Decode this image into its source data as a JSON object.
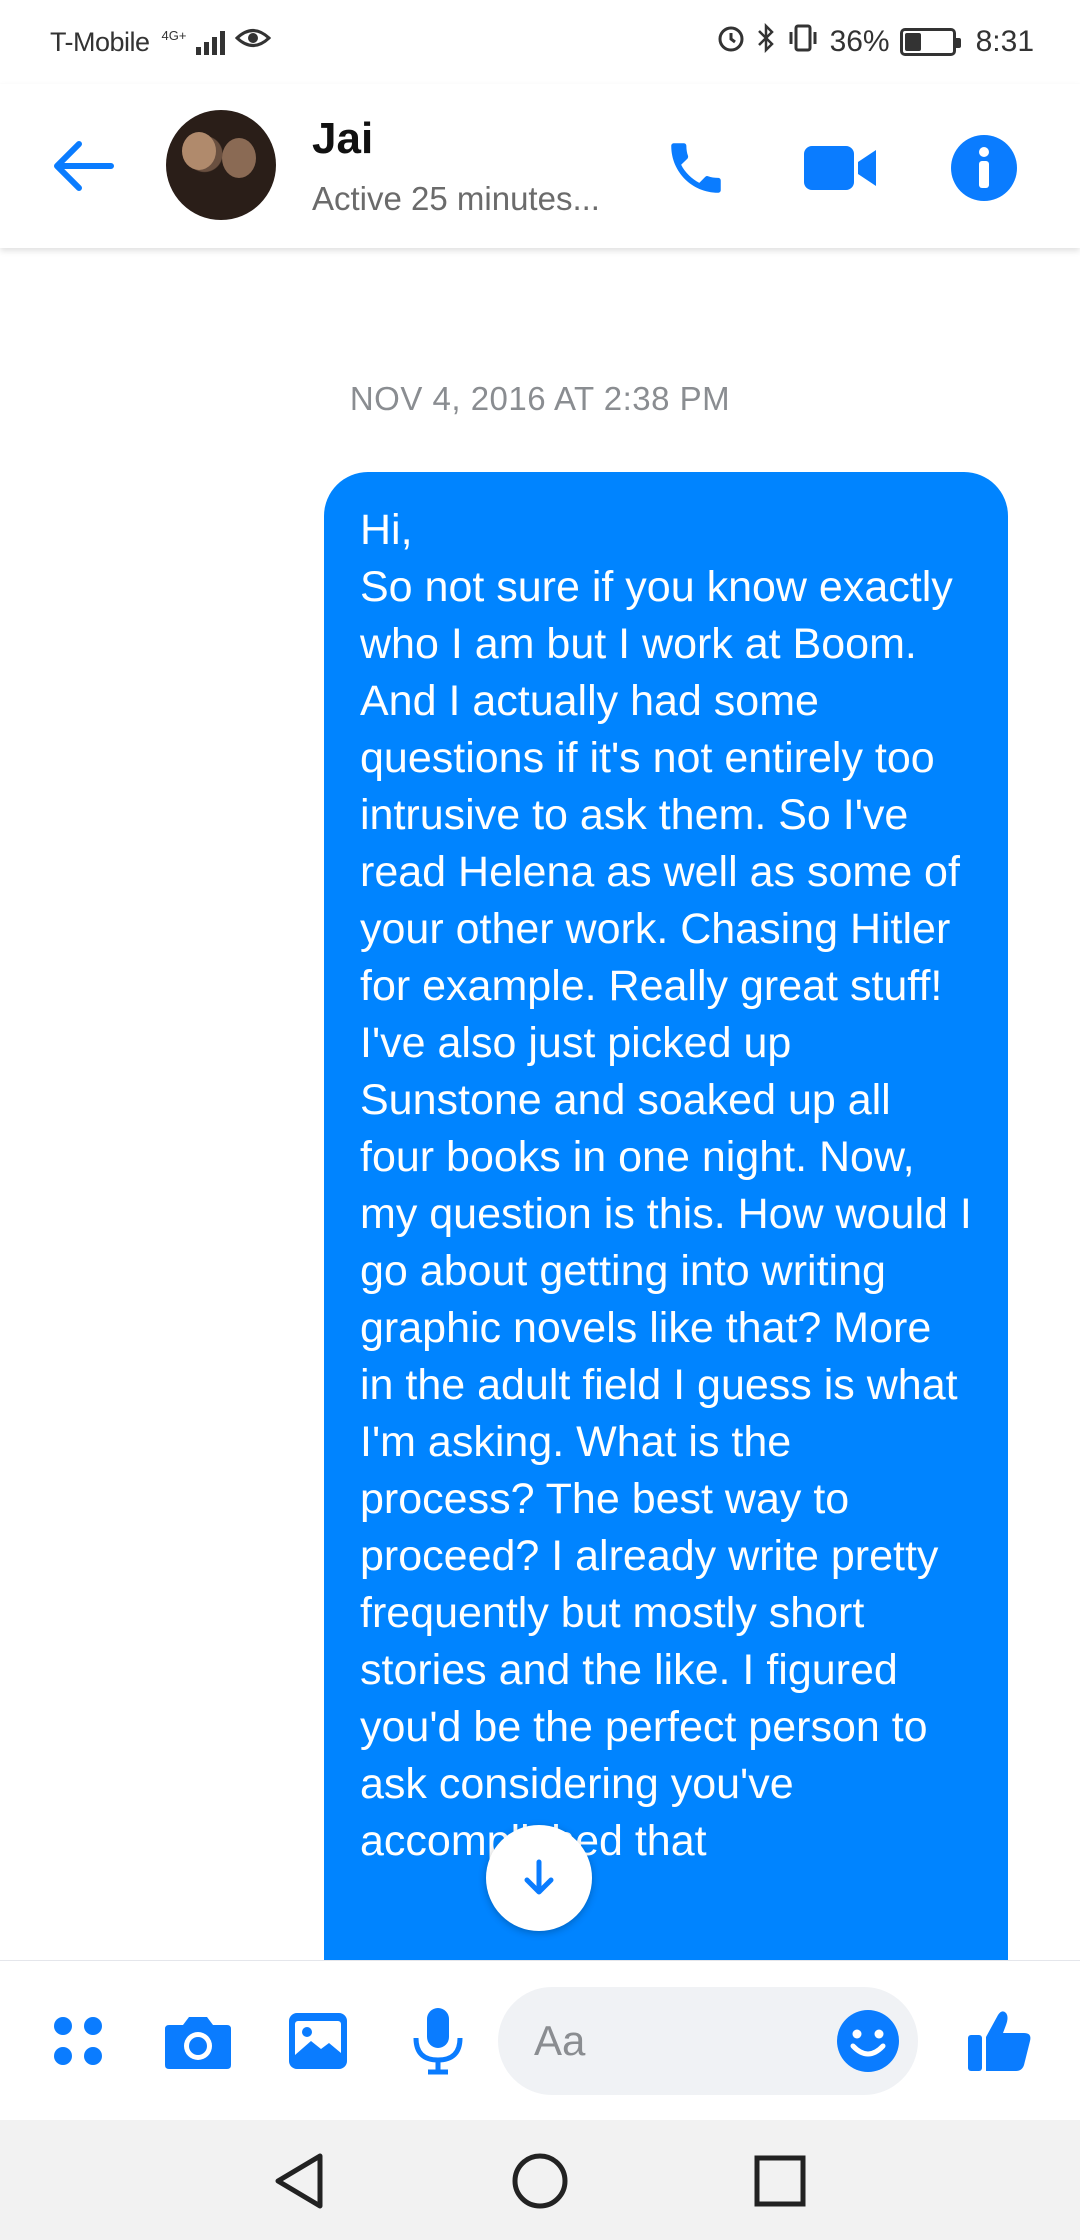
{
  "status_bar": {
    "carrier": "T-Mobile",
    "network": "4G+",
    "battery": "36%",
    "battery_level": 0.36,
    "time": "8:31"
  },
  "header": {
    "contact_name": "Jai",
    "contact_status": "Active 25 minutes...",
    "icons": [
      "back-arrow-icon",
      "phone-icon",
      "video-camera-icon",
      "info-icon"
    ]
  },
  "conversation": {
    "timestamp": "NOV 4, 2016 AT 2:38 PM",
    "message_text": "Hi,\nSo not sure if you know exactly who I am but I work at Boom. And I actually had some questions if it's not entirely too intrusive to ask them. So I've read Helena as well as some of your other work. Chasing Hitler for example. Really great stuff! I've also just picked up Sunstone and soaked up all four books in one night. Now, my question is this. How would I go about getting into writing graphic novels like that? More in the adult field I guess is what I'm asking. What is the process? The best way to proceed? I already write pretty frequently but mostly short stories and the like. I figured you'd be the perfect person to ask considering you've accomplished that"
  },
  "composer": {
    "placeholder": "Aa",
    "icons": [
      "apps-icon",
      "camera-icon",
      "gallery-icon",
      "microphone-icon",
      "emoji-icon",
      "thumbs-up-icon"
    ]
  },
  "colors": {
    "accent": "#0084ff",
    "header_icons": "#0a7cff"
  }
}
